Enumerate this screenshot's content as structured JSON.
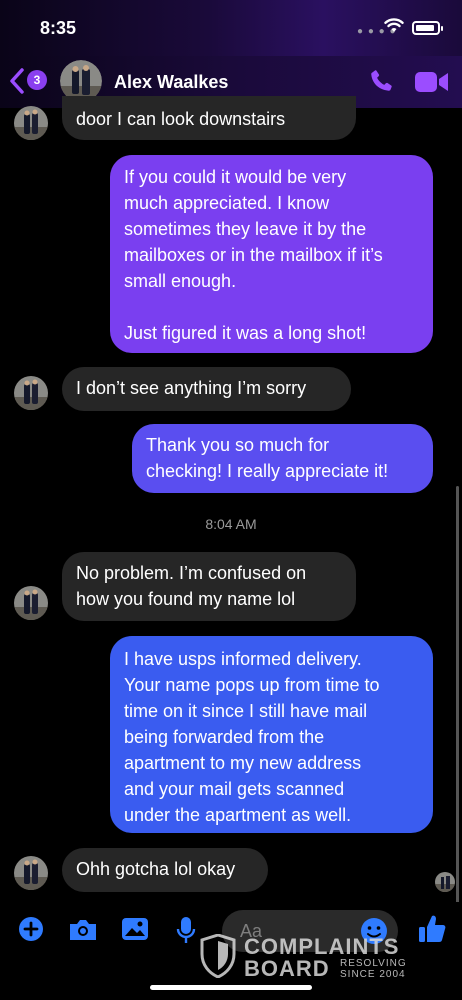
{
  "status_bar": {
    "time": "8:35"
  },
  "header": {
    "back_badge": "3",
    "contact_name": "Alex Waalkes"
  },
  "messages": [
    {
      "text": "door I can look downstairs"
    },
    {
      "text": "If you could it would be very\nmuch appreciated. I know\nsometimes they leave it by the\nmailboxes or in the mailbox if it’s\nsmall enough.\n\nJust figured it was a long shot!"
    },
    {
      "text": "I don’t see anything I’m sorry"
    },
    {
      "text": "Thank you so much for\nchecking! I really appreciate it!"
    },
    {
      "text": "No problem. I’m confused on\nhow you found my name lol"
    },
    {
      "text": "I have usps informed delivery.\nYour name pops up from time to\ntime on it since I still have mail\nbeing forwarded from the\napartment to my new address\nand your mail gets scanned\nunder the apartment as well."
    },
    {
      "text": "Ohh gotcha lol okay"
    }
  ],
  "timestamp": "8:04 AM",
  "composer": {
    "placeholder": "Aa"
  },
  "watermark": {
    "title": "COMPLAINTS",
    "subtitle": "BOARD",
    "tag_line1": "RESOLVING",
    "tag_line2": "SINCE 2004"
  },
  "colors": {
    "accent": "#8a3ff0",
    "incoming_bubble": "#262626",
    "outgoing_top": "#7a3ff0",
    "outgoing_bottom": "#2f62f0",
    "composer_icon": "#2f7bff"
  },
  "icons": [
    "back-chevron",
    "phone",
    "video-camera",
    "plus",
    "camera",
    "image",
    "microphone",
    "emoji",
    "thumbs-up"
  ]
}
